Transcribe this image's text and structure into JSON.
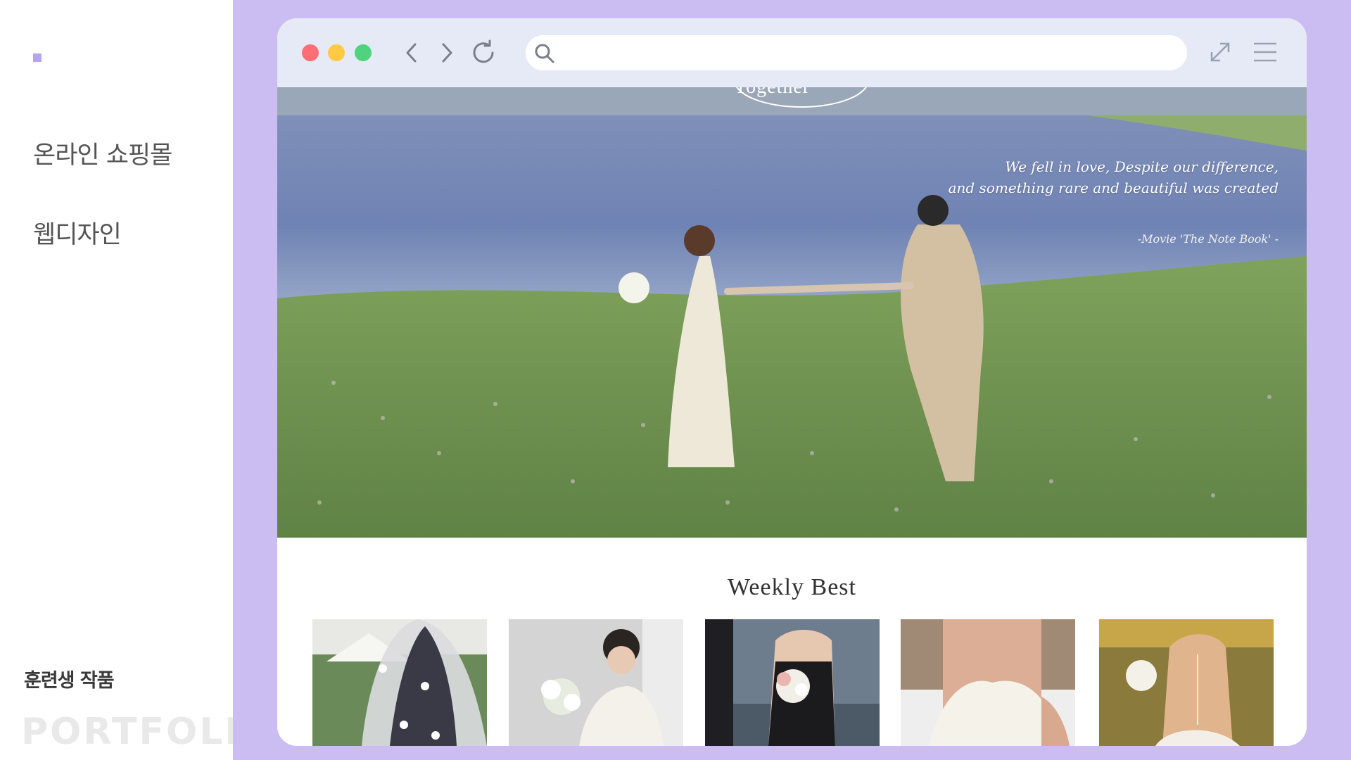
{
  "sidebar": {
    "titles": [
      "온라인 쇼핑몰",
      "웹디자인"
    ],
    "trainee_label": "훈련생 작품",
    "portfolio_label": "PORTFOLIO"
  },
  "colors": {
    "stage_bg": "#cbbcf1",
    "accent": "#b6a5ec",
    "toolbar_bg": "#e5eaf6",
    "traffic_red": "#ff6d75",
    "traffic_yellow": "#ffc943",
    "traffic_green": "#4ed47e"
  },
  "browser": {
    "address_value": "",
    "icons": [
      "back-icon",
      "forward-icon",
      "reload-icon",
      "search-icon",
      "expand-icon",
      "menu-icon"
    ]
  },
  "hero": {
    "badge_text": "Together",
    "quote_line1": "We fell in love, Despite our difference,",
    "quote_line2": "and something rare and beautiful was created",
    "quote_source": "-Movie 'The Note Book' -"
  },
  "weekly_best": {
    "title": "Weekly Best",
    "products": [
      "veil",
      "white-gown-bouquet",
      "black-dress-bouquet",
      "off-shoulder-gown",
      "backless-gown"
    ]
  }
}
